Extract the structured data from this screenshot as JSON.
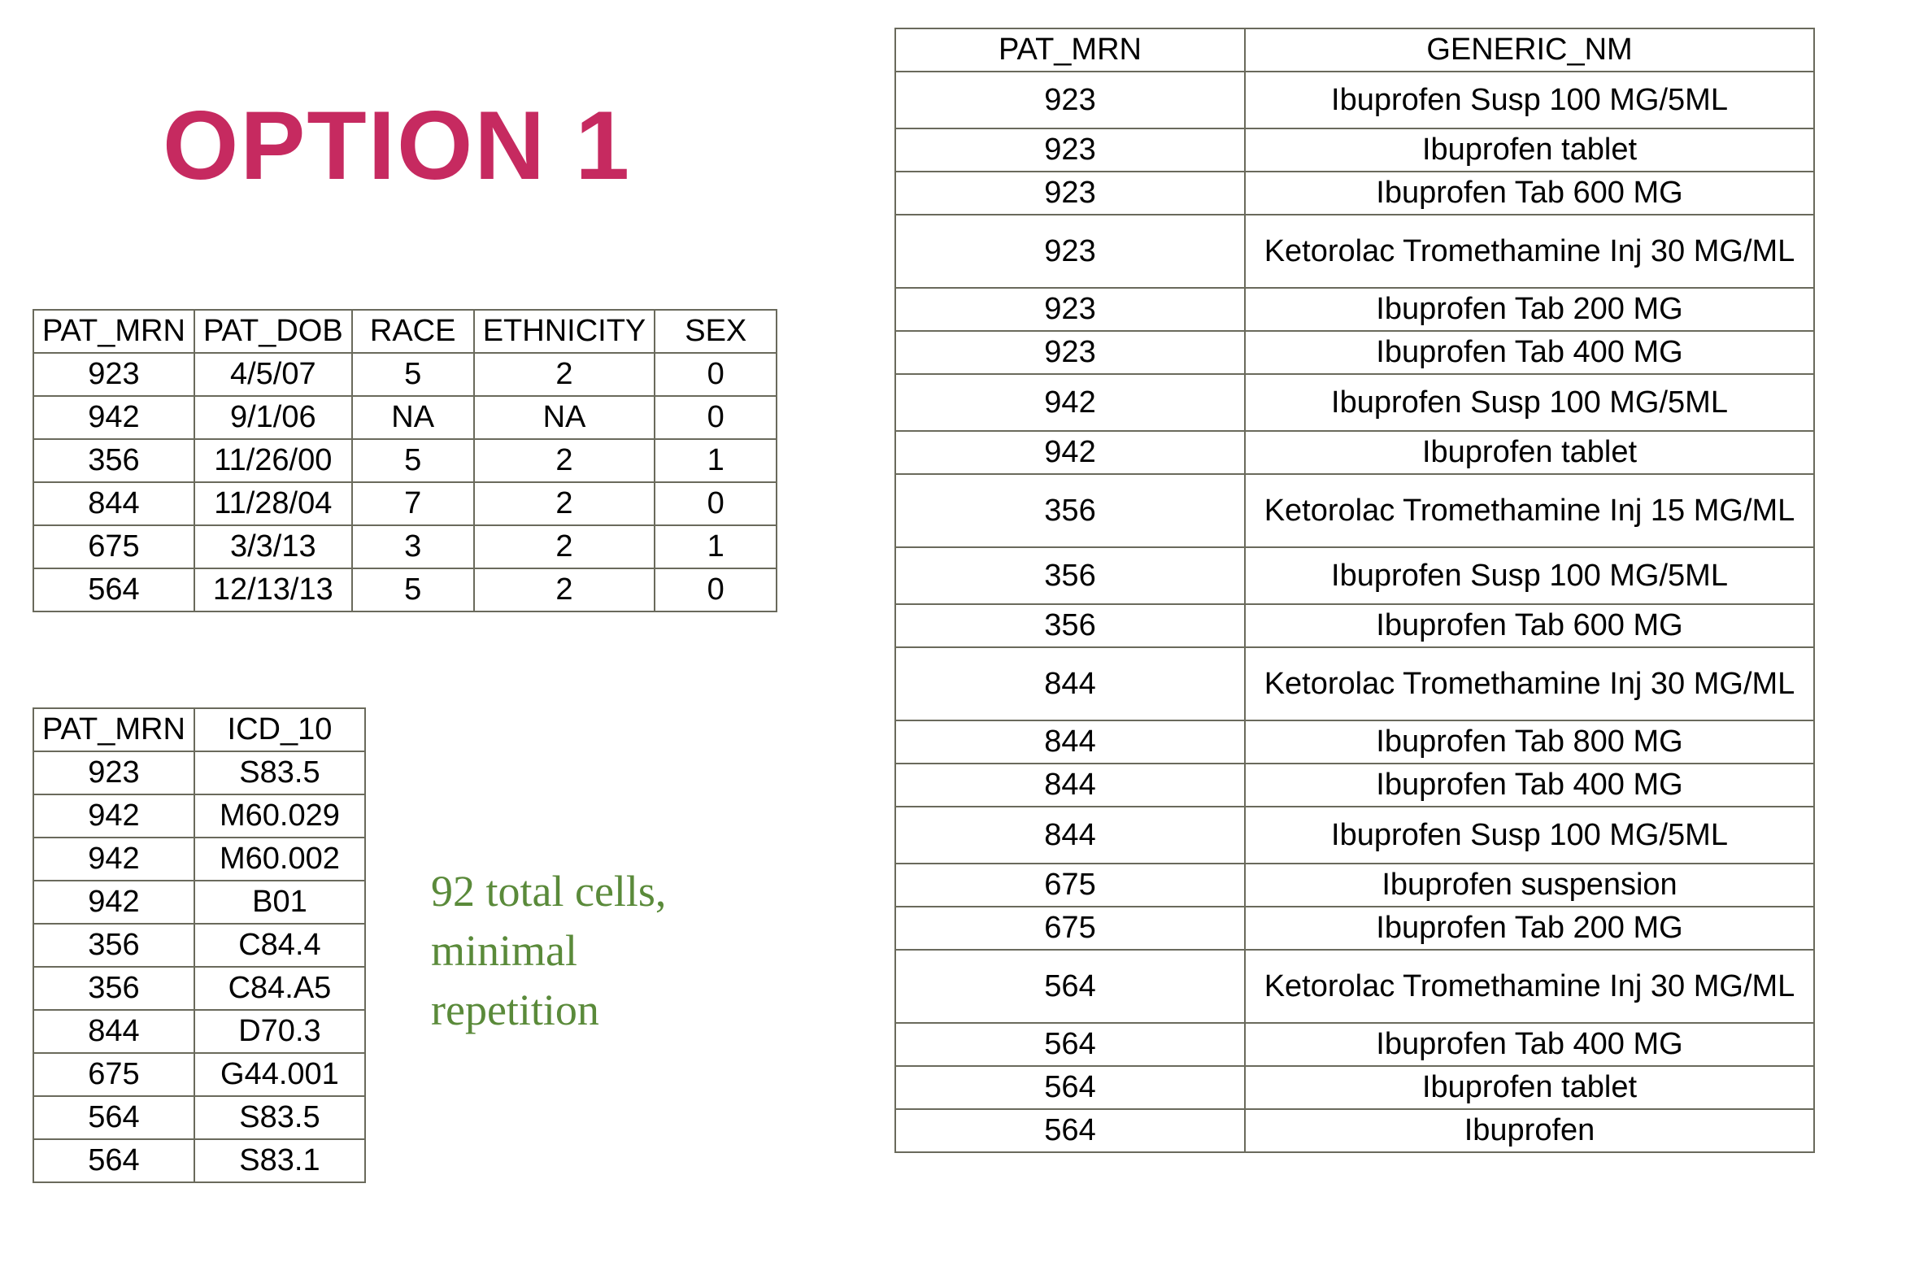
{
  "title": "OPTION 1",
  "caption_line1": "92 total cells,",
  "caption_line2": "minimal",
  "caption_line3": "repetition",
  "table1": {
    "headers": [
      "PAT_MRN",
      "PAT_DOB",
      "RACE",
      "ETHNICITY",
      "SEX"
    ],
    "rows": [
      [
        "923",
        "4/5/07",
        "5",
        "2",
        "0"
      ],
      [
        "942",
        "9/1/06",
        "NA",
        "NA",
        "0"
      ],
      [
        "356",
        "11/26/00",
        "5",
        "2",
        "1"
      ],
      [
        "844",
        "11/28/04",
        "7",
        "2",
        "0"
      ],
      [
        "675",
        "3/3/13",
        "3",
        "2",
        "1"
      ],
      [
        "564",
        "12/13/13",
        "5",
        "2",
        "0"
      ]
    ]
  },
  "table2": {
    "headers": [
      "PAT_MRN",
      "ICD_10"
    ],
    "rows": [
      [
        "923",
        "S83.5"
      ],
      [
        "942",
        "M60.029"
      ],
      [
        "942",
        "M60.002"
      ],
      [
        "942",
        "B01"
      ],
      [
        "356",
        "C84.4"
      ],
      [
        "356",
        "C84.A5"
      ],
      [
        "844",
        "D70.3"
      ],
      [
        "675",
        "G44.001"
      ],
      [
        "564",
        "S83.5"
      ],
      [
        "564",
        "S83.1"
      ]
    ]
  },
  "table3": {
    "headers": [
      "PAT_MRN",
      "GENERIC_NM"
    ],
    "rows": [
      {
        "cells": [
          "923",
          "Ibuprofen Susp 100 MG/5ML"
        ],
        "h": "mid"
      },
      {
        "cells": [
          "923",
          "Ibuprofen tablet"
        ],
        "h": "short"
      },
      {
        "cells": [
          "923",
          "Ibuprofen Tab 600 MG"
        ],
        "h": "short"
      },
      {
        "cells": [
          "923",
          "Ketorolac Tromethamine Inj 30 MG/ML"
        ],
        "h": "tall"
      },
      {
        "cells": [
          "923",
          "Ibuprofen Tab 200 MG"
        ],
        "h": "short"
      },
      {
        "cells": [
          "923",
          "Ibuprofen Tab 400 MG"
        ],
        "h": "short"
      },
      {
        "cells": [
          "942",
          "Ibuprofen Susp 100 MG/5ML"
        ],
        "h": "mid"
      },
      {
        "cells": [
          "942",
          "Ibuprofen tablet"
        ],
        "h": "short"
      },
      {
        "cells": [
          "356",
          "Ketorolac Tromethamine Inj 15 MG/ML"
        ],
        "h": "tall"
      },
      {
        "cells": [
          "356",
          "Ibuprofen Susp 100 MG/5ML"
        ],
        "h": "mid"
      },
      {
        "cells": [
          "356",
          "Ibuprofen Tab 600 MG"
        ],
        "h": "short"
      },
      {
        "cells": [
          "844",
          "Ketorolac Tromethamine Inj 30 MG/ML"
        ],
        "h": "tall"
      },
      {
        "cells": [
          "844",
          "Ibuprofen Tab 800 MG"
        ],
        "h": "short"
      },
      {
        "cells": [
          "844",
          "Ibuprofen Tab 400 MG"
        ],
        "h": "short"
      },
      {
        "cells": [
          "844",
          "Ibuprofen Susp 100 MG/5ML"
        ],
        "h": "mid"
      },
      {
        "cells": [
          "675",
          "Ibuprofen suspension"
        ],
        "h": "short"
      },
      {
        "cells": [
          "675",
          "Ibuprofen Tab 200 MG"
        ],
        "h": "short"
      },
      {
        "cells": [
          "564",
          "Ketorolac Tromethamine Inj 30 MG/ML"
        ],
        "h": "tall"
      },
      {
        "cells": [
          "564",
          "Ibuprofen Tab 400 MG"
        ],
        "h": "short"
      },
      {
        "cells": [
          "564",
          "Ibuprofen tablet"
        ],
        "h": "short"
      },
      {
        "cells": [
          "564",
          "Ibuprofen"
        ],
        "h": "short"
      }
    ]
  }
}
